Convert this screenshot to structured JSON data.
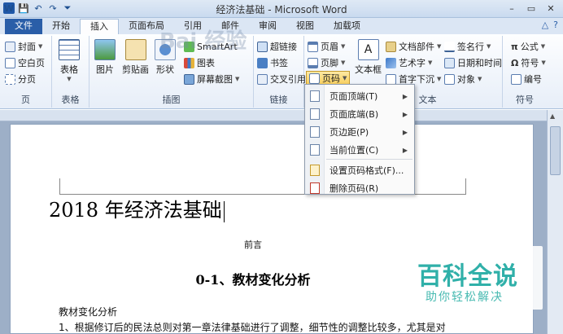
{
  "window": {
    "title": "经济法基础 - Microsoft Word",
    "qat_word": "W",
    "qat_save": "💾",
    "qat_undo": "↶",
    "qat_redo": "↷",
    "qat_more": "⏷",
    "minimize": "–",
    "restore": "▭",
    "close": "✕"
  },
  "tabs": [
    "文件",
    "开始",
    "插入",
    "页面布局",
    "引用",
    "邮件",
    "审阅",
    "视图",
    "加载项"
  ],
  "tab_right": {
    "help": "?",
    "expand": "△"
  },
  "ribbon": {
    "pages": {
      "label": "页",
      "items": [
        "封面",
        "空白页",
        "分页"
      ]
    },
    "table": {
      "label": "表格",
      "button": "表格"
    },
    "illustrations": {
      "label": "插图",
      "picture": "图片",
      "clipart": "剪贴画",
      "shapes": "形状",
      "smartart": "SmartArt",
      "chart": "图表",
      "screenshot": "屏幕截图"
    },
    "links": {
      "label": "链接",
      "items": [
        "超链接",
        "书签",
        "交叉引用"
      ]
    },
    "header_footer": {
      "header": "页眉",
      "footer": "页脚",
      "page_number": "页码"
    },
    "text": {
      "label": "文本",
      "textbox": "文本框",
      "parts": "文档部件",
      "wordart": "艺术字",
      "dropcap": "首字下沉",
      "signature": "签名行",
      "datetime": "日期和时间",
      "object": "对象"
    },
    "symbols": {
      "label": "符号",
      "equation": "公式",
      "symbol": "符号",
      "number": "编号"
    }
  },
  "page_number_menu": {
    "items": [
      {
        "label": "页面顶端(T)",
        "submenu": true
      },
      {
        "label": "页面底端(B)",
        "submenu": true
      },
      {
        "label": "页边距(P)",
        "submenu": true
      },
      {
        "label": "当前位置(C)",
        "submenu": true
      },
      {
        "label": "设置页码格式(F)...",
        "submenu": false
      },
      {
        "label": "删除页码(R)",
        "submenu": false
      }
    ]
  },
  "document": {
    "title": "2018 年经济法基础",
    "preface": "前言",
    "heading": "0-1、教材变化分析",
    "para1": "教材变化分析",
    "para2": "1、根据修订后的民法总则对第一章法律基础进行了调整，细节性的调整比较多，尤其是对"
  },
  "watermark": {
    "main": "百科全说",
    "sub": "助你轻松解决",
    "bg_text": "Bai 经验"
  },
  "colors": {
    "file_tab": "#2a5ea8",
    "accent": "#1aa8a0",
    "pressed": "#f9cf5c"
  }
}
